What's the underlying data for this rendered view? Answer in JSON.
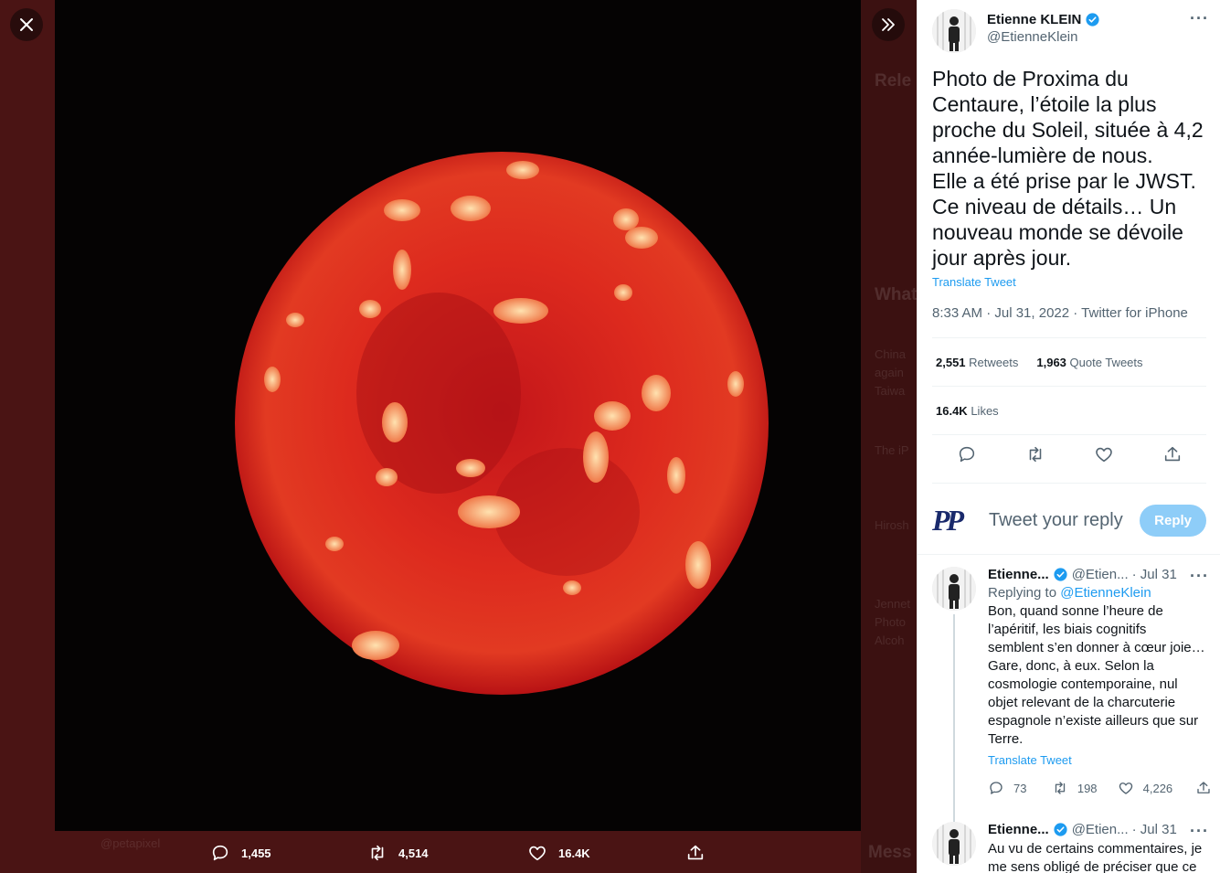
{
  "colors": {
    "accent": "#1d9bf0",
    "reply_button_bg": "#8ecdf8",
    "backdrop": "#4a1414"
  },
  "media": {
    "description_icon": "image",
    "actions": {
      "replies": "1,455",
      "retweets": "4,514",
      "likes": "16.4K"
    }
  },
  "tweet": {
    "author_name": "Etienne KLEIN",
    "author_handle": "@EtienneKlein",
    "text": "Photo de Proxima du\nCentaure, l’étoile la plus\nproche du Soleil, située à 4,2\nannée-lumière de nous.\nElle a été prise par le JWST.\nCe niveau de détails… Un\nnouveau monde se dévoile\njour après jour.",
    "translate_label": "Translate Tweet",
    "meta": "8:33 AM · Jul 31, 2022 · Twitter for iPhone",
    "retweets_count": "2,551",
    "retweets_label": "Retweets",
    "quote_count": "1,963",
    "quote_label": "Quote Tweets",
    "likes_count": "16.4K",
    "likes_label": "Likes"
  },
  "reply_box": {
    "placeholder": "Tweet your reply",
    "button": "Reply",
    "logo_text": "PP"
  },
  "replies": [
    {
      "name": "Etienne...",
      "handle": "@Etien...",
      "date": "· Jul 31",
      "replying_prefix": "Replying to",
      "replying_to": "@EtienneKlein",
      "text": "Bon, quand sonne l’heure de\nl’apéritif, les biais cognitifs\nsemblent s’en donner  à cœur joie…\nGare, donc, à eux. Selon la\ncosmologie contemporaine, nul\nobjet relevant de la charcuterie\nespagnole n’existe ailleurs que sur\nTerre.",
      "translate_label": "Translate Tweet",
      "replies_count": "73",
      "retweets_count": "198",
      "likes_count": "4,226"
    },
    {
      "name": "Etienne...",
      "handle": "@Etien...",
      "date": "· Jul 31",
      "text": "Au vu de certains commentaires, je\nme sens obligé de préciser que ce"
    }
  ],
  "backdrop_ghost": {
    "relevant": "Rele",
    "whats": "What",
    "trend1": "China",
    "trend1b": "again",
    "trend1c": "Taiwa",
    "trend2": "The iP",
    "trend3": "Hirosh",
    "trend4": "Jennet",
    "trend4b": "Photo",
    "trend4c": "Alcoh",
    "messages": "Mess",
    "footer_handle": "@petapixel"
  }
}
